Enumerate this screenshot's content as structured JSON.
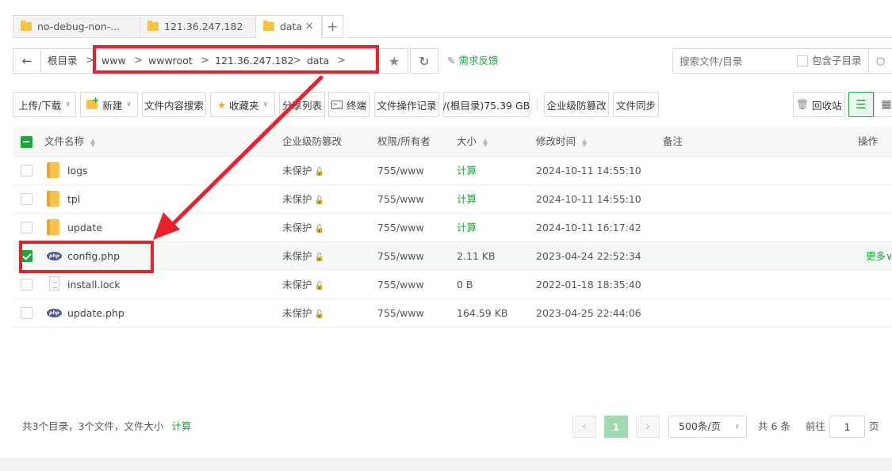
{
  "tabs": [
    {
      "label": "no-debug-non-..."
    },
    {
      "label": "121.36.247.182"
    },
    {
      "label": "data",
      "close": "×"
    }
  ],
  "tab_add": "+",
  "address": {
    "root": "根目录",
    "parts": [
      "www",
      "wwwroot",
      "121.36.247.182",
      "data"
    ]
  },
  "feedback": "需求反馈",
  "search": {
    "placeholder": "搜索文件/目录",
    "subdir_label": "包含子目录"
  },
  "toolbar": {
    "upload": "上传/下载",
    "new": "新建",
    "content_search": "文件内容搜索",
    "favorites": "收藏夹",
    "share_list": "分享列表",
    "terminal": "终端",
    "op_log": "文件操作记录",
    "disk": "/(根目录)75.39 GB",
    "tamper": "企业级防篡改",
    "sync": "文件同步",
    "recycle": "回收站"
  },
  "table": {
    "headers": {
      "name": "文件名称",
      "protect": "企业级防篡改",
      "perm": "权限/所有者",
      "size": "大小",
      "mtime": "修改时间",
      "note": "备注",
      "ops": "操作"
    },
    "rows": [
      {
        "name": "logs",
        "type": "folder",
        "protect": "未保护",
        "perm": "755/www",
        "size": "计算",
        "mtime": "2024-10-11 14:55:10"
      },
      {
        "name": "tpl",
        "type": "folder",
        "protect": "未保护",
        "perm": "755/www",
        "size": "计算",
        "mtime": "2024-10-11 14:55:10"
      },
      {
        "name": "update",
        "type": "folder",
        "protect": "未保护",
        "perm": "755/www",
        "size": "计算",
        "mtime": "2024-10-11 16:17:42"
      },
      {
        "name": "config.php",
        "type": "php",
        "protect": "未保护",
        "perm": "755/www",
        "size": "2.11 KB",
        "mtime": "2023-04-24 22:52:34",
        "more": "更多∨"
      },
      {
        "name": "install.lock",
        "type": "text",
        "protect": "未保护",
        "perm": "755/www",
        "size": "0 B",
        "mtime": "2022-01-18 18:35:40"
      },
      {
        "name": "update.php",
        "type": "php",
        "protect": "未保护",
        "perm": "755/www",
        "size": "164.59 KB",
        "mtime": "2023-04-25 22:44:06"
      }
    ]
  },
  "footer": {
    "summary": "共3个目录，3个文件，文件大小",
    "calc": "计算",
    "current_page": "1",
    "page_size": "500条/页",
    "total": "共 6 条",
    "goto_prefix": "前往",
    "goto_value": "1",
    "goto_suffix": "页"
  },
  "colors": {
    "accent": "#20a53a",
    "annotation": "#e8222b"
  }
}
